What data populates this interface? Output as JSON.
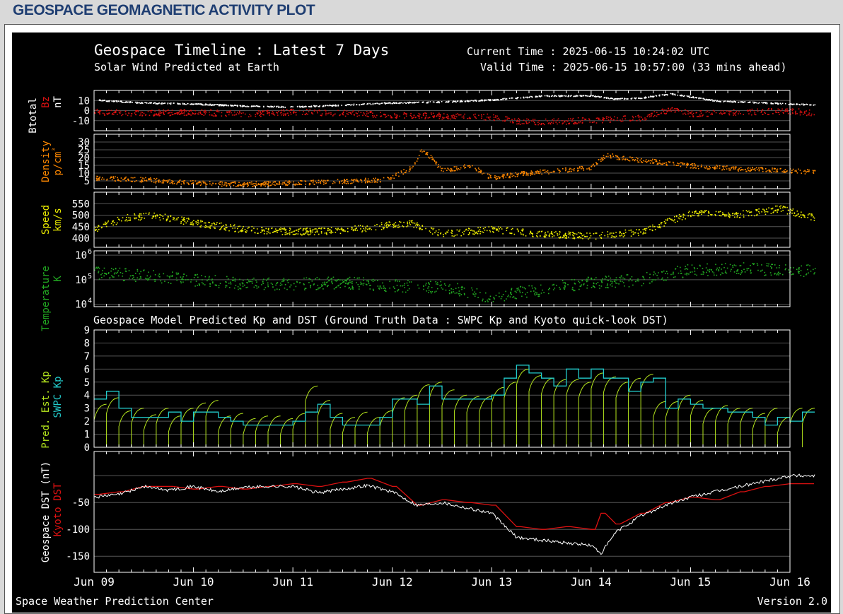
{
  "page": {
    "title": "GEOSPACE GEOMAGNETIC ACTIVITY PLOT"
  },
  "plot": {
    "title": "Geospace Timeline : Latest 7 Days",
    "subtitle": "Solar Wind Predicted at Earth",
    "current_time": "Current Time : 2025-06-15 10:24:02 UTC",
    "valid_time": "Valid Time : 2025-06-15 10:57:00 (33 mins ahead)",
    "kp_section_title": "Geospace Model Predicted Kp and DST (Ground Truth Data : SWPC Kp and Kyoto quick-look DST)",
    "footer_left": "Space Weather Prediction Center",
    "footer_right": "Version 2.0",
    "colors": {
      "background": "#000000",
      "grid": "#555555",
      "btotal": "#ffffff",
      "bz": "#dd1111",
      "density": "#ff8800",
      "speed": "#eeee00",
      "temperature": "#22aa22",
      "pred_kp": "#b5e61d",
      "swpc_kp": "#22cccc",
      "geospace_dst": "#ffffff",
      "kyoto_dst": "#dd1111"
    }
  },
  "chart_data": [
    {
      "type": "scatter",
      "panel": "magnetic-field",
      "ylabel_parts": [
        "Btotal",
        "Bz",
        "nT"
      ],
      "yticks": [
        "10",
        "0",
        "-10"
      ],
      "ylim": [
        -20,
        20
      ],
      "xlim": [
        0,
        7.5
      ],
      "series": [
        {
          "name": "Btotal",
          "x": [
            0,
            0.5,
            1,
            1.5,
            2,
            2.5,
            3,
            3.5,
            4,
            4.25,
            4.5,
            5,
            5.25,
            5.5,
            5.8,
            6,
            6.25,
            6.5,
            7,
            7.25
          ],
          "y": [
            11,
            8,
            7,
            5,
            4,
            6,
            8,
            9,
            11,
            13,
            15,
            15,
            12,
            13,
            17,
            14,
            10,
            9,
            7,
            6
          ]
        },
        {
          "name": "Bz",
          "x": [
            0,
            0.5,
            1,
            1.5,
            2,
            2.5,
            3,
            3.5,
            4,
            4.25,
            4.5,
            5,
            5.25,
            5.5,
            5.8,
            6,
            6.25,
            6.5,
            7,
            7.25
          ],
          "y": [
            -1,
            -2,
            -1,
            -3,
            -1,
            -2,
            -4,
            -5,
            -6,
            -10,
            -11,
            -9,
            -8,
            -7,
            2,
            -3,
            -2,
            -1,
            0,
            -2
          ]
        }
      ]
    },
    {
      "type": "scatter",
      "panel": "density",
      "ylabel_parts": [
        "Density",
        "p/cm³"
      ],
      "yticks": [
        "30",
        "25",
        "20",
        "15",
        "10",
        "5"
      ],
      "ylim": [
        0,
        35
      ],
      "xlim": [
        0,
        7.5
      ],
      "series": [
        {
          "name": "Density",
          "x": [
            0,
            0.5,
            1,
            1.5,
            2,
            2.5,
            2.9,
            3,
            3.2,
            3.3,
            3.5,
            3.8,
            4,
            4.3,
            4.7,
            5,
            5.15,
            5.3,
            6,
            6.5,
            7,
            7.25
          ],
          "y": [
            7,
            6,
            4,
            3,
            4,
            5,
            6,
            8,
            14,
            26,
            12,
            15,
            7,
            10,
            12,
            14,
            22,
            20,
            15,
            13,
            12,
            11
          ]
        }
      ]
    },
    {
      "type": "scatter",
      "panel": "speed",
      "ylabel_parts": [
        "Speed",
        "km/s"
      ],
      "yticks": [
        "550",
        "500",
        "450",
        "400"
      ],
      "ylim": [
        360,
        600
      ],
      "xlim": [
        0,
        7.5
      ],
      "series": [
        {
          "name": "Speed",
          "x": [
            0,
            0.3,
            0.6,
            1,
            1.5,
            2,
            2.5,
            3,
            3.2,
            3.5,
            4,
            4.5,
            5,
            5.5,
            6,
            6.5,
            6.9,
            7.25
          ],
          "y": [
            440,
            490,
            500,
            470,
            440,
            430,
            435,
            460,
            465,
            420,
            440,
            420,
            410,
            430,
            510,
            505,
            530,
            490
          ]
        }
      ]
    },
    {
      "type": "scatter",
      "panel": "temperature",
      "ylabel_parts": [
        "Temperature",
        "K"
      ],
      "yticks": [
        "10^6",
        "10^5",
        "10^4"
      ],
      "yscale": "log",
      "ylim": [
        8000,
        1500000
      ],
      "xlim": [
        0,
        7.5
      ],
      "series": [
        {
          "name": "Temperature",
          "x": [
            0,
            0.5,
            1,
            1.5,
            2,
            2.5,
            3,
            3.5,
            4,
            4.5,
            5,
            5.5,
            6,
            6.5,
            7,
            7.25
          ],
          "y": [
            200000,
            150000,
            100000,
            70000,
            70000,
            80000,
            60000,
            50000,
            20000,
            40000,
            80000,
            100000,
            250000,
            300000,
            250000,
            250000
          ]
        }
      ]
    },
    {
      "type": "line",
      "panel": "kp",
      "ylabel_parts": [
        "Pred. Est. Kp",
        "SWPC Kp"
      ],
      "yticks": [
        "9",
        "8",
        "7",
        "6",
        "5",
        "4",
        "3",
        "2",
        "1",
        "0"
      ],
      "ylim": [
        0,
        9
      ],
      "xlim": [
        0,
        7.5
      ],
      "series": [
        {
          "name": "SWPC Kp",
          "x": [
            0,
            0.125,
            0.25,
            0.375,
            0.5,
            0.625,
            0.75,
            0.875,
            1,
            1.125,
            1.25,
            1.375,
            1.5,
            1.625,
            1.75,
            1.875,
            2,
            2.125,
            2.25,
            2.375,
            2.5,
            2.625,
            2.75,
            2.875,
            3,
            3.125,
            3.25,
            3.375,
            3.5,
            3.625,
            3.75,
            3.875,
            4,
            4.125,
            4.25,
            4.375,
            4.5,
            4.625,
            4.75,
            4.875,
            5,
            5.125,
            5.25,
            5.375,
            5.5,
            5.625,
            5.75,
            5.875,
            6,
            6.125,
            6.25,
            6.375,
            6.5,
            6.625,
            6.75,
            6.875,
            7,
            7.125
          ],
          "y": [
            3.7,
            4.3,
            3,
            2.3,
            2.3,
            2.3,
            2.7,
            2,
            2.7,
            2.7,
            2.3,
            2,
            1.7,
            1.7,
            1.7,
            1.7,
            2,
            2.7,
            3.3,
            2.3,
            1.7,
            1.7,
            1.7,
            2.3,
            3.7,
            3.7,
            3.3,
            4.7,
            3.7,
            3.7,
            3.7,
            3.7,
            4,
            5.3,
            6.3,
            5.7,
            5.3,
            4.7,
            6,
            5.3,
            6,
            5.3,
            5.3,
            4.3,
            5,
            5.3,
            3,
            3.7,
            3.3,
            3,
            3,
            2.7,
            2.7,
            2.3,
            1.7,
            2.3,
            2,
            2.7
          ]
        },
        {
          "name": "Pred. Est. Kp",
          "x": [
            0,
            0.125,
            0.25,
            0.375,
            0.5,
            0.625,
            0.75,
            0.875,
            1,
            1.125,
            1.25,
            1.375,
            1.5,
            1.625,
            1.75,
            1.875,
            2,
            2.125,
            2.25,
            2.375,
            2.5,
            2.625,
            2.75,
            2.875,
            3,
            3.125,
            3.25,
            3.375,
            3.5,
            3.625,
            3.75,
            3.875,
            4,
            4.125,
            4.25,
            4.375,
            4.5,
            4.625,
            4.75,
            4.875,
            5,
            5.125,
            5.25,
            5.375,
            5.5,
            5.625,
            5.75,
            5.875,
            6,
            6.125,
            6.25,
            6.375,
            6.5,
            6.625,
            6.75,
            6.875,
            7,
            7.125
          ],
          "y": [
            3.3,
            3.8,
            2.8,
            3,
            2.5,
            3,
            2.4,
            3,
            3.4,
            3.6,
            2.4,
            2.6,
            2.2,
            2.4,
            2.4,
            2.2,
            2.6,
            4.7,
            3.6,
            2.6,
            2.3,
            2.7,
            2.3,
            2.8,
            3.8,
            4,
            4.8,
            5,
            4.4,
            4,
            3.9,
            3.9,
            4.6,
            5,
            6,
            5.5,
            5.3,
            5.2,
            5.2,
            5,
            5.7,
            5.4,
            5,
            5.3,
            5.6,
            3.5,
            3.5,
            4,
            3.6,
            3,
            3.2,
            3,
            3,
            2.6,
            3,
            2.3,
            3,
            3
          ]
        }
      ]
    },
    {
      "type": "line",
      "panel": "dst",
      "ylabel_parts": [
        "Geospace DST (nT)",
        "Kyoto DST"
      ],
      "yticks": [
        "-50",
        "-100",
        "-150"
      ],
      "ylim": [
        -180,
        45
      ],
      "xlim": [
        0,
        7.5
      ],
      "series": [
        {
          "name": "Geospace DST",
          "x": [
            0,
            0.25,
            0.5,
            0.75,
            1,
            1.25,
            1.5,
            1.75,
            2,
            2.25,
            2.5,
            2.75,
            3,
            3.25,
            3.5,
            3.75,
            4,
            4.25,
            4.5,
            4.75,
            5,
            5.1,
            5.25,
            5.5,
            5.75,
            6,
            6.25,
            6.5,
            6.75,
            7,
            7.25
          ],
          "y": [
            -40,
            -35,
            -20,
            -27,
            -20,
            -30,
            -22,
            -20,
            -20,
            -32,
            -25,
            -18,
            -30,
            -55,
            -50,
            -60,
            -70,
            -115,
            -120,
            -125,
            -130,
            -145,
            -105,
            -75,
            -55,
            -40,
            -30,
            -20,
            -10,
            0,
            0
          ]
        },
        {
          "name": "Kyoto DST",
          "x": [
            0,
            0.25,
            0.5,
            0.75,
            1,
            1.25,
            1.5,
            1.75,
            2,
            2.25,
            2.5,
            2.75,
            3,
            3.25,
            3.5,
            3.75,
            4,
            4.25,
            4.5,
            4.75,
            5,
            5.1,
            5.25,
            5.5,
            5.75,
            6,
            6.25,
            6.5,
            6.75,
            7,
            7.2
          ],
          "y": [
            -35,
            -30,
            -20,
            -20,
            -25,
            -20,
            -25,
            -20,
            -15,
            -20,
            -12,
            -5,
            -20,
            -55,
            -45,
            -50,
            -55,
            -95,
            -100,
            -95,
            -100,
            -70,
            -90,
            -70,
            -50,
            -40,
            -45,
            -30,
            -20,
            -15,
            -15
          ]
        }
      ]
    }
  ],
  "x_axis": {
    "tick_labels": [
      "Jun 09",
      "Jun 10",
      "Jun 11",
      "Jun 12",
      "Jun 13",
      "Jun 14",
      "Jun 15",
      "Jun 16"
    ],
    "tick_values": [
      0,
      1,
      2,
      3,
      4,
      5,
      6,
      7
    ]
  }
}
